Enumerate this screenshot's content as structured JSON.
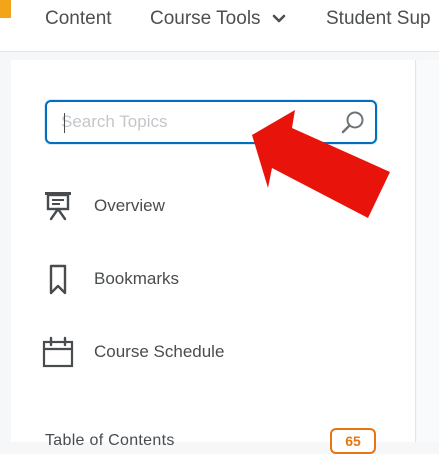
{
  "nav": {
    "items": [
      {
        "label": "Content"
      },
      {
        "label": "Course Tools"
      },
      {
        "label": "Student Sup"
      }
    ]
  },
  "search": {
    "placeholder": "Search Topics",
    "value": ""
  },
  "menu": {
    "overview": {
      "label": "Overview",
      "icon": "presentation-board-icon"
    },
    "bookmarks": {
      "label": "Bookmarks",
      "icon": "bookmark-icon"
    },
    "schedule": {
      "label": "Course Schedule",
      "icon": "calendar-icon"
    }
  },
  "toc": {
    "label": "Table of Contents",
    "count": "65"
  },
  "colors": {
    "brand": "#f2a51a",
    "focus_border": "#006fbf",
    "badge": "#e87511",
    "annotation_arrow": "#e8140b"
  }
}
